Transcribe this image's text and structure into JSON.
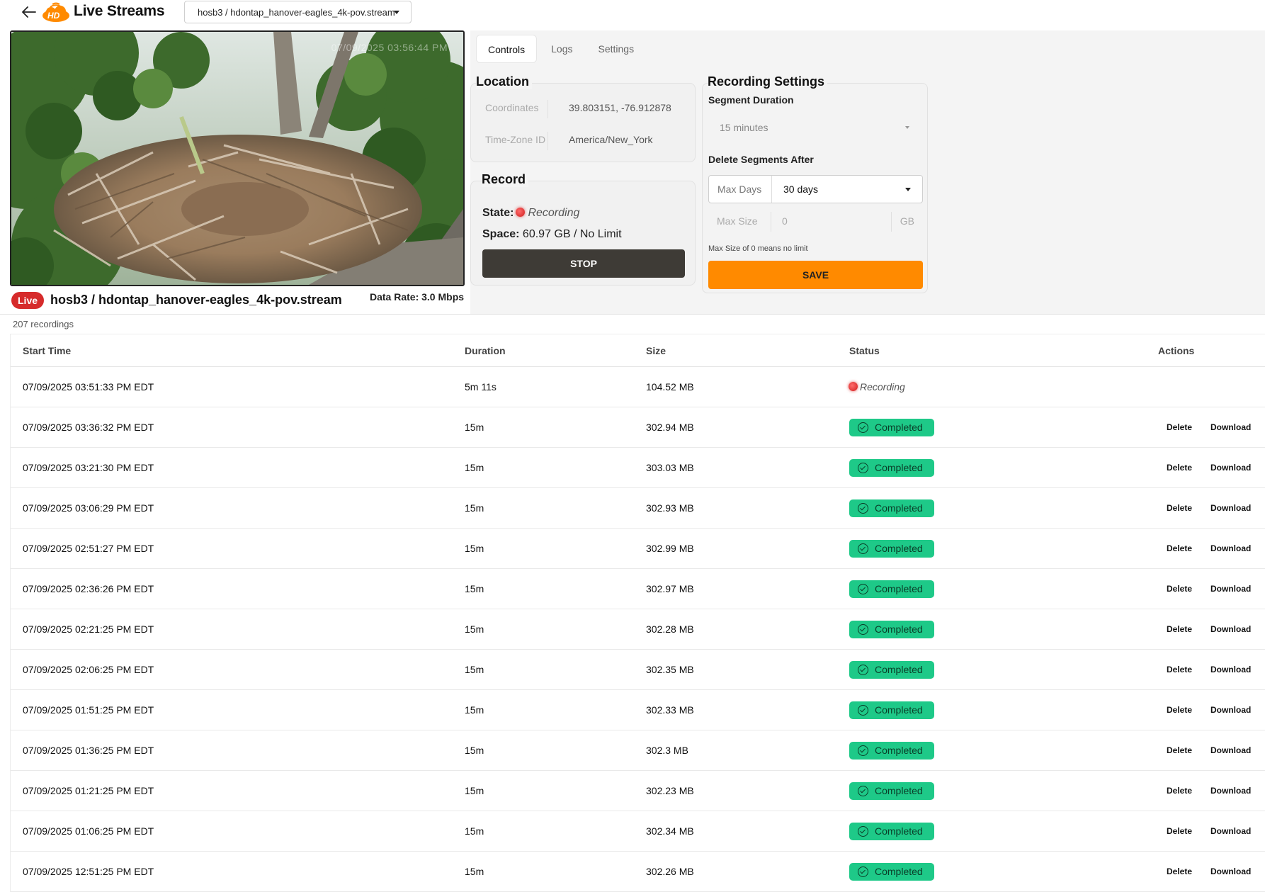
{
  "header": {
    "title": "Live Streams",
    "logo_text": "HD",
    "stream_selected": "hosb3 / hdontap_hanover-eagles_4k-pov.stream"
  },
  "video": {
    "timestamp": "07/09/2025 03:56:44 PM"
  },
  "stream_info": {
    "live_label": "Live",
    "name": "hosb3 / hdontap_hanover-eagles_4k-pov.stream",
    "data_rate": "Data Rate: 3.0 Mbps"
  },
  "tabs": [
    {
      "label": "Controls",
      "active": true
    },
    {
      "label": "Logs",
      "active": false
    },
    {
      "label": "Settings",
      "active": false
    }
  ],
  "location": {
    "title": "Location",
    "coordinates_label": "Coordinates",
    "coordinates_value": "39.803151, -76.912878",
    "timezone_label": "Time-Zone ID",
    "timezone_value": "America/New_York"
  },
  "record": {
    "title": "Record",
    "state_label": "State:",
    "state_value": "Recording",
    "space_label": "Space:",
    "space_value": "60.97 GB / No Limit",
    "stop_label": "STOP"
  },
  "recording_settings": {
    "title": "Recording Settings",
    "segment_duration_label": "Segment Duration",
    "segment_duration_value": "15 minutes",
    "delete_after_label": "Delete Segments After",
    "max_days_label": "Max Days",
    "max_days_value": "30 days",
    "max_size_label": "Max Size",
    "max_size_value": "0",
    "max_size_unit": "GB",
    "hint": "Max Size of 0 means no limit",
    "save_label": "SAVE"
  },
  "recordings": {
    "count_label": "207 recordings",
    "columns": [
      "Start Time",
      "Duration",
      "Size",
      "Status",
      "Actions"
    ],
    "delete_label": "Delete",
    "download_label": "Download",
    "rows": [
      {
        "start": "07/09/2025 03:51:33 PM EDT",
        "duration": "5m 11s",
        "size": "104.52 MB",
        "status": "Recording"
      },
      {
        "start": "07/09/2025 03:36:32 PM EDT",
        "duration": "15m",
        "size": "302.94 MB",
        "status": "Completed"
      },
      {
        "start": "07/09/2025 03:21:30 PM EDT",
        "duration": "15m",
        "size": "303.03 MB",
        "status": "Completed"
      },
      {
        "start": "07/09/2025 03:06:29 PM EDT",
        "duration": "15m",
        "size": "302.93 MB",
        "status": "Completed"
      },
      {
        "start": "07/09/2025 02:51:27 PM EDT",
        "duration": "15m",
        "size": "302.99 MB",
        "status": "Completed"
      },
      {
        "start": "07/09/2025 02:36:26 PM EDT",
        "duration": "15m",
        "size": "302.97 MB",
        "status": "Completed"
      },
      {
        "start": "07/09/2025 02:21:25 PM EDT",
        "duration": "15m",
        "size": "302.28 MB",
        "status": "Completed"
      },
      {
        "start": "07/09/2025 02:06:25 PM EDT",
        "duration": "15m",
        "size": "302.35 MB",
        "status": "Completed"
      },
      {
        "start": "07/09/2025 01:51:25 PM EDT",
        "duration": "15m",
        "size": "302.33 MB",
        "status": "Completed"
      },
      {
        "start": "07/09/2025 01:36:25 PM EDT",
        "duration": "15m",
        "size": "302.3 MB",
        "status": "Completed"
      },
      {
        "start": "07/09/2025 01:21:25 PM EDT",
        "duration": "15m",
        "size": "302.23 MB",
        "status": "Completed"
      },
      {
        "start": "07/09/2025 01:06:25 PM EDT",
        "duration": "15m",
        "size": "302.34 MB",
        "status": "Completed"
      },
      {
        "start": "07/09/2025 12:51:25 PM EDT",
        "duration": "15m",
        "size": "302.26 MB",
        "status": "Completed"
      }
    ]
  },
  "colors": {
    "accent_orange": "#ff8a00",
    "live_red": "#d62b2b",
    "completed_green": "#1ec988",
    "stop_dark": "#3e3b36"
  }
}
